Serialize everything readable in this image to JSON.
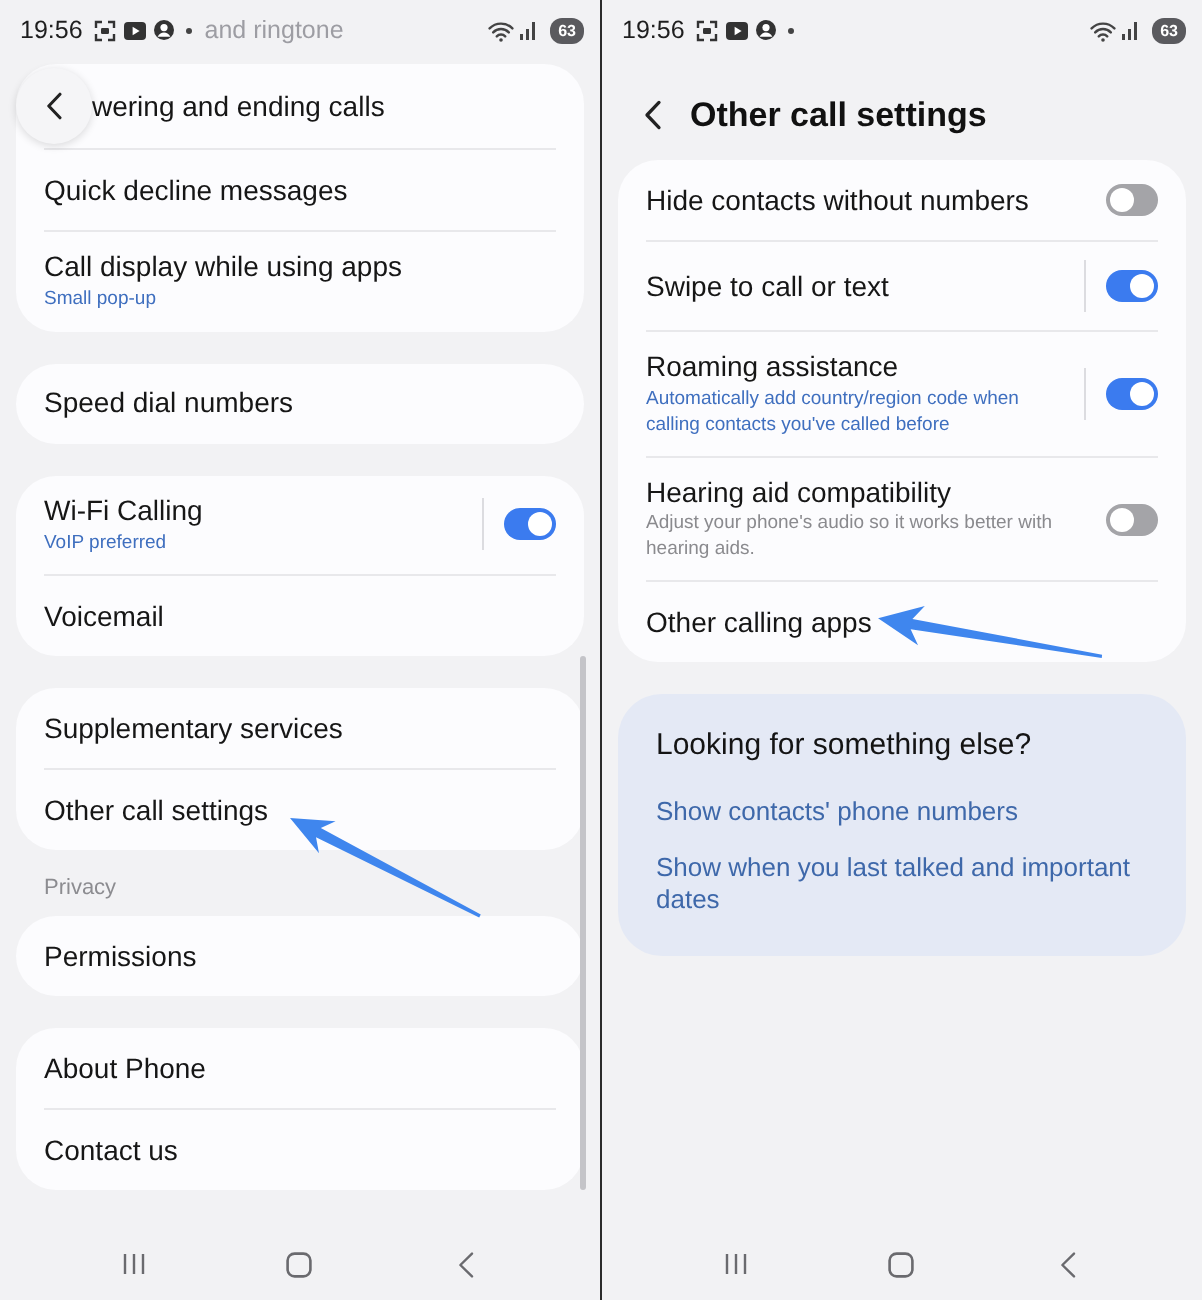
{
  "left_screen": {
    "kind": "list",
    "status_bar": {
      "time": "19:56",
      "battery": "63"
    },
    "faded_title": "and ringtone",
    "groups": [
      {
        "items": [
          {
            "kind": "link",
            "title": "wering and ending calls",
            "callout": false
          },
          {
            "kind": "link",
            "title": "Quick decline messages",
            "callout": false
          },
          {
            "kind": "link",
            "title": "Call display while using apps",
            "subtitle": "Small pop-up",
            "callout": false
          }
        ]
      },
      {
        "items": [
          {
            "kind": "link",
            "title": "Speed dial numbers",
            "callout": false
          }
        ]
      },
      {
        "items": [
          {
            "kind": "switch",
            "title": "Wi-Fi Calling",
            "subtitle": "VoIP preferred",
            "on": true,
            "split": true,
            "callout": false
          },
          {
            "kind": "link",
            "title": "Voicemail",
            "callout": false
          }
        ]
      },
      {
        "items": [
          {
            "kind": "link",
            "title": "Supplementary services",
            "callout": false
          },
          {
            "kind": "link",
            "title": "Other call settings",
            "callout": true
          }
        ]
      },
      {
        "header": "Privacy",
        "items": [
          {
            "kind": "link",
            "title": "Permissions",
            "callout": false
          }
        ]
      },
      {
        "items": [
          {
            "kind": "link",
            "title": "About Phone",
            "callout": false
          },
          {
            "kind": "link",
            "title": "Contact us",
            "callout": false
          }
        ]
      }
    ]
  },
  "right_screen": {
    "kind": "detail",
    "status_bar": {
      "time": "19:56",
      "battery": "63"
    },
    "header": {
      "title": "Other call settings"
    },
    "groups": [
      {
        "items": [
          {
            "kind": "switch",
            "title": "Hide contacts without numbers",
            "on": false,
            "split": false,
            "callout": false
          },
          {
            "kind": "switch",
            "title": "Swipe to call or text",
            "on": true,
            "split": true,
            "callout": false
          },
          {
            "kind": "switch",
            "title": "Roaming assistance",
            "subtitle": "Automatically add country/region code when calling contacts you've called before",
            "on": true,
            "split": true,
            "callout": false
          },
          {
            "kind": "switch",
            "title": "Hearing aid compatibility",
            "description": "Adjust your phone's audio so it works better with hearing aids.",
            "on": false,
            "split": false,
            "callout": false
          },
          {
            "kind": "link",
            "title": "Other calling apps",
            "callout": true
          }
        ]
      }
    ],
    "suggestions": {
      "title": "Looking for something else?",
      "links": [
        "Show contacts' phone numbers",
        "Show when you last talked and important dates"
      ]
    }
  }
}
